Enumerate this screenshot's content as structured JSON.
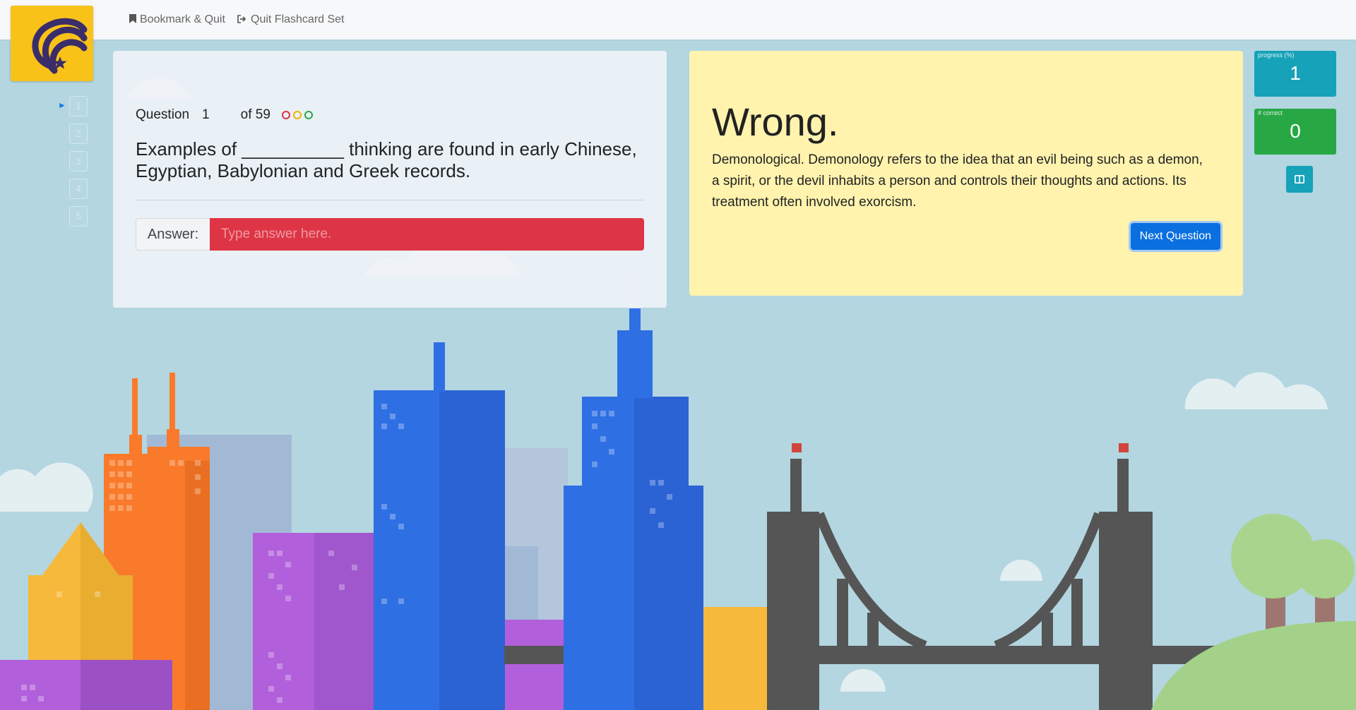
{
  "nav": {
    "bookmark_label": "Bookmark & Quit",
    "quit_label": "Quit Flashcard Set"
  },
  "question_list": [
    "1",
    "2",
    "3",
    "4",
    "5"
  ],
  "question": {
    "label": "Question",
    "number": "1",
    "of_label": "of 59",
    "text": "Examples of __________ thinking are found in early Chinese, Egyptian, Babylonian and Greek records.",
    "indicator_colors": [
      "#dd3545",
      "#f0b400",
      "#28a745"
    ]
  },
  "answer": {
    "label": "Answer:",
    "placeholder": "Type answer here."
  },
  "feedback": {
    "title": "Wrong.",
    "explanation": "Demonological. Demonology refers to the idea that an evil being such as a demon, a spirit, or the devil inhabits a person and controls their thoughts and actions. Its treatment often involved exorcism.",
    "next_label": "Next Question"
  },
  "stats": {
    "progress_label": "progress (%)",
    "progress_value": "1",
    "correct_label": "# correct",
    "correct_value": "0"
  },
  "colors": {
    "progress": "#16a2b8",
    "correct": "#28a745",
    "wrong_input": "#dd3545",
    "primary": "#0a6fdf",
    "feedback_bg": "#fff3ae"
  }
}
